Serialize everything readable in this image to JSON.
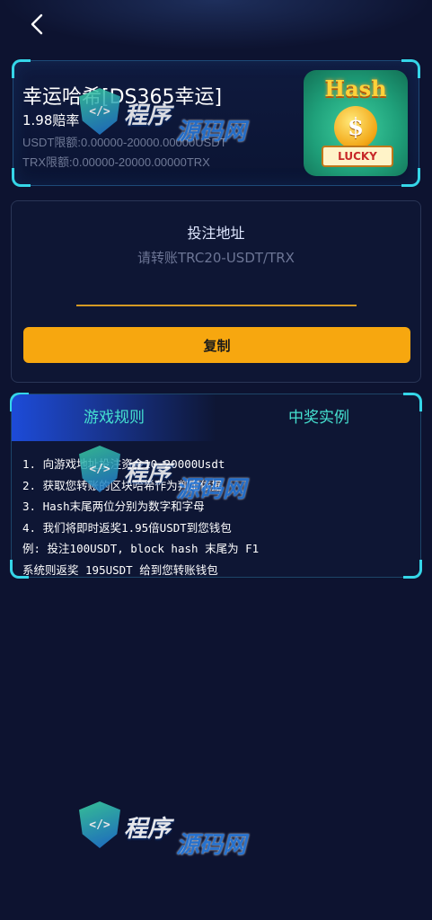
{
  "header": {
    "back_icon": "chevron-left-icon"
  },
  "game": {
    "title": "幸运哈希[DS365幸运]",
    "odds": "1.98赔率",
    "limit_usdt": "USDT限额:0.00000-20000.00000USDT",
    "limit_trx": "TRX限额:0.00000-20000.00000TRX",
    "thumb_hash_text": "Hash",
    "thumb_coin_text": "$",
    "thumb_lucky_text": "LUCKY"
  },
  "bet": {
    "title": "投注地址",
    "placeholder": "请转账TRC20-USDT/TRX",
    "copy_label": "复制"
  },
  "rules": {
    "tab_rules": "游戏规则",
    "tab_examples": "中奖实例",
    "lines": [
      "1. 向游戏地址投注资金10-20000Usdt",
      "2. 获取您转账的区块哈希作为判定依据",
      "3. Hash末尾两位分别为数字和字母",
      "4. 我们将即时返奖1.95倍USDT到您钱包",
      "例: 投注100USDT, block hash 末尾为 F1",
      "系统则返奖 195USDT 给到您转账钱包"
    ]
  },
  "watermark": {
    "icon_text": "</>",
    "text1": "程序",
    "text2": "源码网"
  },
  "colors": {
    "background": "#0d1330",
    "accent_cyan": "#35d6e8",
    "tab_text": "#45e0d0",
    "button": "#f7a70f",
    "underline": "#d49a24"
  }
}
